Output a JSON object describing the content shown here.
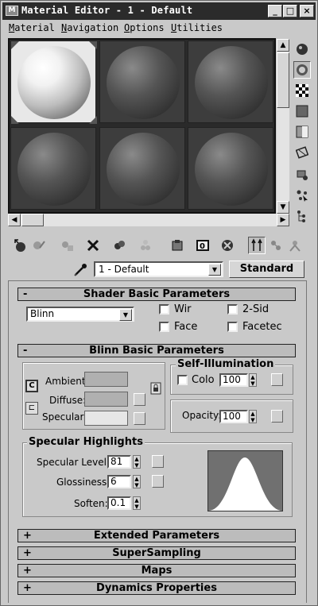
{
  "window": {
    "title": "Material Editor - 1 - Default",
    "icon_label": "M",
    "minimize_glyph": "_",
    "maximize_glyph": "□",
    "close_glyph": "×"
  },
  "menu": [
    {
      "label": "Material",
      "hotkey": "M",
      "rest": "aterial"
    },
    {
      "label": "Navigation",
      "hotkey": "N",
      "rest": "avigation"
    },
    {
      "label": "Options",
      "hotkey": "O",
      "rest": "ptions"
    },
    {
      "label": "Utilities",
      "hotkey": "U",
      "rest": "tilities"
    }
  ],
  "sample_slots": {
    "count": 6,
    "active_index": 0
  },
  "side_toolbar": [
    "sample-type-sphere-icon",
    "backlight-icon",
    "background-checker-icon",
    "sample-uv-tiling-icon",
    "video-color-check-icon",
    "make-preview-icon",
    "options-icon",
    "select-by-material-icon",
    "material-map-navigator-icon"
  ],
  "bottom_toolbar": [
    "get-material-icon",
    "put-to-scene-icon",
    "assign-to-selection-icon",
    "reset-map-icon",
    "make-unique-icon",
    "put-to-library-icon",
    "material-effects-channel-icon",
    "show-map-in-viewport-icon",
    "show-end-result-icon",
    "go-to-parent-icon",
    "go-forward-sibling-icon"
  ],
  "material": {
    "name": "1 - Default",
    "type_button": "Standard"
  },
  "shader_basic": {
    "title": "Shader Basic Parameters",
    "collapse_sign": "-",
    "shader_value": "Blinn",
    "wire_label": "Wir",
    "two_sided_label": "2-Sid",
    "face_map_label": "Face",
    "faceted_label": "Facetec"
  },
  "blinn_basic": {
    "title": "Blinn Basic Parameters",
    "collapse_sign": "-",
    "ambient_label": "Ambient:",
    "diffuse_label": "Diffuse:",
    "specular_label": "Specular:",
    "lock_glyph": "C",
    "self_illum_title": "Self-Illumination",
    "color_label": "Colo",
    "self_illum_value": "100",
    "opacity_label": "Opacity:",
    "opacity_value": "100"
  },
  "specular_highlights": {
    "title": "Specular Highlights",
    "specular_level_label": "Specular Level:",
    "specular_level_value": "81",
    "glossiness_label": "Glossiness:",
    "glossiness_value": "6",
    "soften_label": "Soften:",
    "soften_value": "0.1"
  },
  "collapsed_rollouts": [
    {
      "sign": "+",
      "title": "Extended Parameters"
    },
    {
      "sign": "+",
      "title": "SuperSampling"
    },
    {
      "sign": "+",
      "title": "Maps"
    },
    {
      "sign": "+",
      "title": "Dynamics Properties"
    }
  ],
  "colors": {
    "title_bar": "#2b2b2b",
    "panel_bg": "#c9c9c9",
    "curve_bg": "#707070",
    "curve_fill": "#ffffff"
  }
}
